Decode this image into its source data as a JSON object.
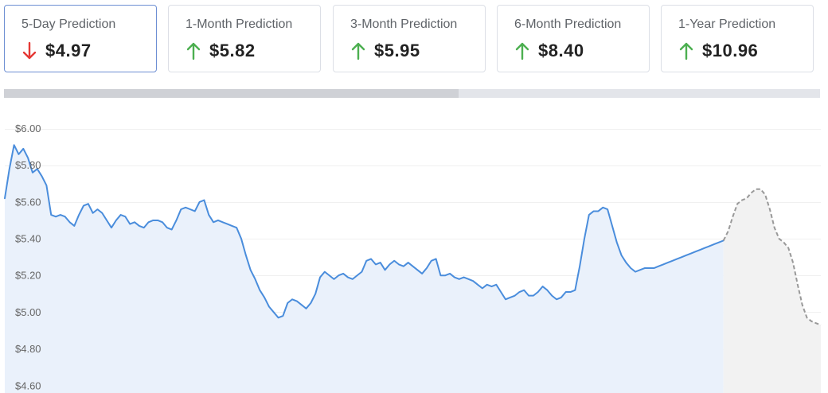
{
  "cards": [
    {
      "label": "5-Day Prediction",
      "value": "$4.97",
      "direction": "down",
      "active": true
    },
    {
      "label": "1-Month Prediction",
      "value": "$5.82",
      "direction": "up",
      "active": false
    },
    {
      "label": "3-Month Prediction",
      "value": "$5.95",
      "direction": "up",
      "active": false
    },
    {
      "label": "6-Month Prediction",
      "value": "$8.40",
      "direction": "up",
      "active": false
    },
    {
      "label": "1-Year Prediction",
      "value": "$10.96",
      "direction": "up",
      "active": false
    }
  ],
  "colors": {
    "up": "#4caf50",
    "down": "#e53935",
    "historical_line": "#4a8ddc",
    "historical_fill": "#eaf1fb",
    "forecast_line": "#999999",
    "forecast_fill": "#f2f2f2",
    "active_border": "#6d8fd3"
  },
  "range_bar": {
    "visible_fraction": 0.557
  },
  "chart_data": {
    "type": "area",
    "ylim": [
      4.56,
      6.05
    ],
    "yticks": [
      6.0,
      5.8,
      5.6,
      5.4,
      5.2,
      5.0,
      4.8,
      4.6
    ],
    "ytick_labels": [
      "$6.00",
      "$5.80",
      "$5.60",
      "$5.40",
      "$5.20",
      "$5.00",
      "$4.80",
      "$4.60"
    ],
    "grid": true,
    "legend": "none",
    "x_count": 177,
    "historical_end_index": 155,
    "series": [
      {
        "style": "solid",
        "x": [
          0,
          1,
          2,
          3,
          4,
          5,
          6,
          7,
          8,
          9,
          10,
          11,
          12,
          13,
          14,
          15,
          16,
          17,
          18,
          19,
          20,
          21,
          22,
          23,
          24,
          25,
          26,
          27,
          28,
          29,
          30,
          31,
          32,
          33,
          34,
          35,
          36,
          37,
          38,
          39,
          40,
          41,
          42,
          43,
          44,
          45,
          46,
          47,
          48,
          49,
          50,
          51,
          52,
          53,
          54,
          55,
          56,
          57,
          58,
          59,
          60,
          61,
          62,
          63,
          64,
          65,
          66,
          67,
          68,
          69,
          70,
          71,
          72,
          73,
          74,
          75,
          76,
          77,
          78,
          79,
          80,
          81,
          82,
          83,
          84,
          85,
          86,
          87,
          88,
          89,
          90,
          91,
          92,
          93,
          94,
          95,
          96,
          97,
          98,
          99,
          100,
          101,
          102,
          103,
          104,
          105,
          106,
          107,
          108,
          109,
          110,
          111,
          112,
          113,
          114,
          115,
          116,
          117,
          118,
          119,
          120,
          121,
          122,
          123,
          124,
          125,
          126,
          127,
          128,
          129,
          130,
          131,
          132,
          133,
          134,
          135,
          136,
          137,
          138,
          139,
          140,
          141,
          142,
          143,
          144,
          145,
          146,
          147,
          148,
          149,
          150,
          151,
          152,
          153,
          154,
          155
        ],
        "values": [
          5.62,
          5.78,
          5.91,
          5.86,
          5.89,
          5.84,
          5.76,
          5.78,
          5.74,
          5.69,
          5.53,
          5.52,
          5.53,
          5.52,
          5.49,
          5.47,
          5.53,
          5.58,
          5.59,
          5.54,
          5.56,
          5.54,
          5.5,
          5.46,
          5.5,
          5.53,
          5.52,
          5.48,
          5.49,
          5.47,
          5.46,
          5.49,
          5.5,
          5.5,
          5.49,
          5.46,
          5.45,
          5.5,
          5.56,
          5.57,
          5.56,
          5.55,
          5.6,
          5.61,
          5.53,
          5.49,
          5.5,
          5.49,
          5.48,
          5.47,
          5.46,
          5.4,
          5.31,
          5.23,
          5.18,
          5.12,
          5.08,
          5.03,
          5.0,
          4.97,
          4.98,
          5.05,
          5.07,
          5.06,
          5.04,
          5.02,
          5.05,
          5.1,
          5.19,
          5.22,
          5.2,
          5.18,
          5.2,
          5.21,
          5.19,
          5.18,
          5.2,
          5.22,
          5.28,
          5.29,
          5.26,
          5.27,
          5.23,
          5.26,
          5.28,
          5.26,
          5.25,
          5.27,
          5.25,
          5.23,
          5.21,
          5.24,
          5.28,
          5.29,
          5.2,
          5.2,
          5.21,
          5.19,
          5.18,
          5.19,
          5.18,
          5.17,
          5.15,
          5.13,
          5.15,
          5.14,
          5.15,
          5.11,
          5.07,
          5.08,
          5.09,
          5.11,
          5.12,
          5.09,
          5.09,
          5.11,
          5.14,
          5.12,
          5.09,
          5.07,
          5.08,
          5.11,
          5.11,
          5.12,
          5.25,
          5.4,
          5.53,
          5.55,
          5.55,
          5.57,
          5.56,
          5.47,
          5.38,
          5.31,
          5.27,
          5.24,
          5.22,
          5.23,
          5.24,
          5.24,
          5.24,
          5.25,
          5.26,
          5.27,
          5.28,
          5.29,
          5.3,
          5.31,
          5.32,
          5.33,
          5.34,
          5.35,
          5.36,
          5.37,
          5.38,
          5.39
        ]
      },
      {
        "style": "dashed",
        "x": [
          155,
          156,
          157,
          158,
          159,
          160,
          161,
          162,
          163,
          164,
          165,
          166,
          167,
          168,
          169,
          170,
          171,
          172,
          173,
          174,
          175,
          176
        ],
        "values": [
          5.39,
          5.44,
          5.52,
          5.59,
          5.61,
          5.62,
          5.65,
          5.67,
          5.67,
          5.64,
          5.56,
          5.46,
          5.4,
          5.38,
          5.35,
          5.27,
          5.15,
          5.04,
          4.97,
          4.95,
          4.94,
          4.93
        ]
      }
    ]
  }
}
